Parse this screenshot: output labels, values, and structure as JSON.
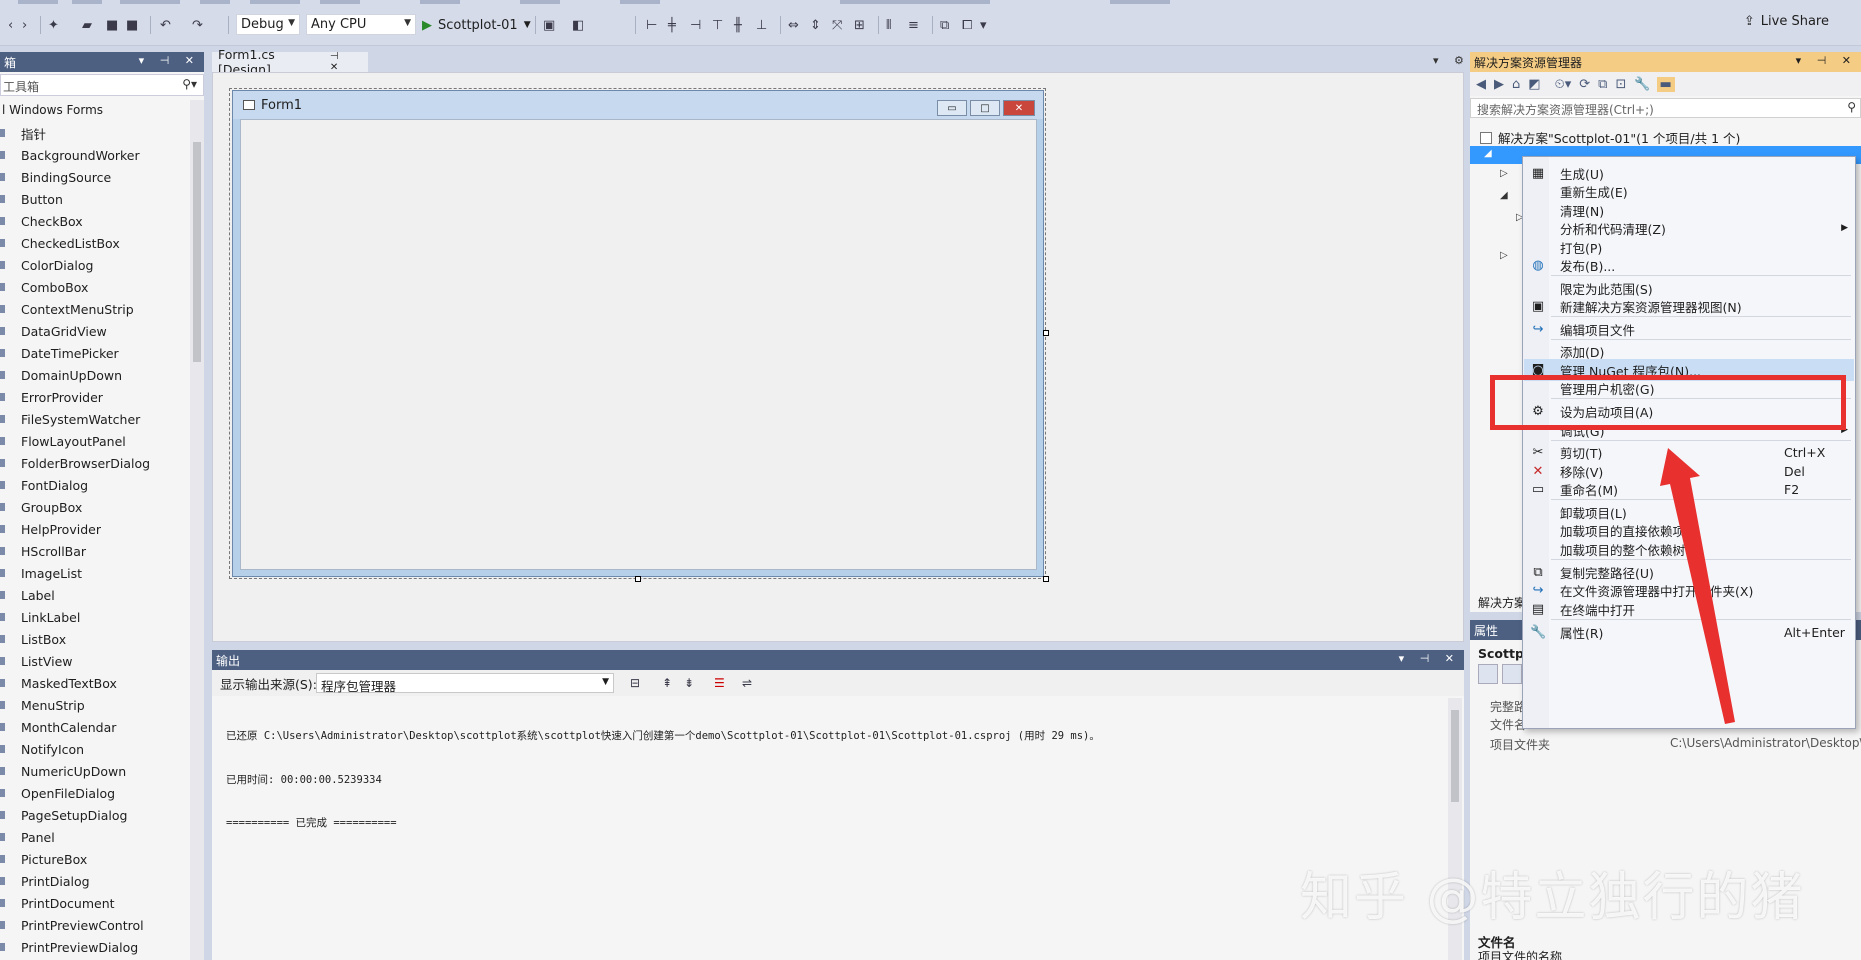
{
  "toolbar": {
    "config": "Debug",
    "platform": "Any CPU",
    "run_target": "Scottplot-01",
    "live_share": "Live Share"
  },
  "toolbox": {
    "title": "箱",
    "search_placeholder": "工具箱",
    "group": "l Windows Forms",
    "items": [
      "指针",
      "BackgroundWorker",
      "BindingSource",
      "Button",
      "CheckBox",
      "CheckedListBox",
      "ColorDialog",
      "ComboBox",
      "ContextMenuStrip",
      "DataGridView",
      "DateTimePicker",
      "DomainUpDown",
      "ErrorProvider",
      "FileSystemWatcher",
      "FlowLayoutPanel",
      "FolderBrowserDialog",
      "FontDialog",
      "GroupBox",
      "HelpProvider",
      "HScrollBar",
      "ImageList",
      "Label",
      "LinkLabel",
      "ListBox",
      "ListView",
      "MaskedTextBox",
      "MenuStrip",
      "MonthCalendar",
      "NotifyIcon",
      "NumericUpDown",
      "OpenFileDialog",
      "PageSetupDialog",
      "Panel",
      "PictureBox",
      "PrintDialog",
      "PrintDocument",
      "PrintPreviewControl",
      "PrintPreviewDialog"
    ]
  },
  "document": {
    "tab_label": "Form1.cs [Design]",
    "form_title": "Form1"
  },
  "output": {
    "title": "输出",
    "source_label": "显示输出来源(S):",
    "source_value": "程序包管理器",
    "lines": [
      "已还原 C:\\Users\\Administrator\\Desktop\\scottplot系统\\scottplot快速入门创建第一个demo\\Scottplot-01\\Scottplot-01\\Scottplot-01.csproj (用时 29 ms)。",
      "已用时间: 00:00:00.5239334",
      "========== 已完成 =========="
    ]
  },
  "solution": {
    "title": "解决方案资源管理器",
    "search_placeholder": "搜索解决方案资源管理器(Ctrl+;)",
    "root": "解决方案\"Scottplot-01\"(1 个项目/共 1 个)",
    "bottom_label": "解决方案"
  },
  "properties": {
    "title": "属性",
    "object": "Scottpl",
    "rows": [
      {
        "name": "完整路",
        "value": ""
      },
      {
        "name": "文件名",
        "value": ""
      },
      {
        "name": "项目文件夹",
        "value": "C:\\Users\\Administrator\\Desktop\\"
      }
    ],
    "desc_title": "文件名",
    "desc_text": "项目文件的名称"
  },
  "context_menu": {
    "items": [
      {
        "label": "生成(U)",
        "shortcut": "",
        "icon": "build-icon",
        "submenu": false
      },
      {
        "label": "重新生成(E)",
        "shortcut": "",
        "icon": "",
        "submenu": false
      },
      {
        "label": "清理(N)",
        "shortcut": "",
        "icon": "",
        "submenu": false
      },
      {
        "label": "分析和代码清理(Z)",
        "shortcut": "",
        "icon": "",
        "submenu": true
      },
      {
        "label": "打包(P)",
        "shortcut": "",
        "icon": "",
        "submenu": false
      },
      {
        "label": "发布(B)...",
        "shortcut": "",
        "icon": "globe-icon",
        "submenu": false
      },
      {
        "label": "限定为此范围(S)",
        "shortcut": "",
        "icon": "",
        "submenu": false
      },
      {
        "label": "新建解决方案资源管理器视图(N)",
        "shortcut": "",
        "icon": "new-view-icon",
        "submenu": false
      },
      {
        "label": "编辑项目文件",
        "shortcut": "",
        "icon": "edit-arrow-icon",
        "submenu": false
      },
      {
        "label": "添加(D)",
        "shortcut": "",
        "icon": "",
        "submenu": false
      },
      {
        "label": "管理 NuGet 程序包(N)...",
        "shortcut": "",
        "icon": "nuget-icon",
        "submenu": false
      },
      {
        "label": "管理用户机密(G)",
        "shortcut": "",
        "icon": "",
        "submenu": false
      },
      {
        "label": "设为启动项目(A)",
        "shortcut": "",
        "icon": "gear-icon",
        "submenu": false
      },
      {
        "label": "调试(G)",
        "shortcut": "",
        "icon": "",
        "submenu": true
      },
      {
        "label": "剪切(T)",
        "shortcut": "Ctrl+X",
        "icon": "scissors-icon",
        "submenu": false
      },
      {
        "label": "移除(V)",
        "shortcut": "Del",
        "icon": "remove-x-icon",
        "submenu": false
      },
      {
        "label": "重命名(M)",
        "shortcut": "F2",
        "icon": "rename-icon",
        "submenu": false
      },
      {
        "label": "卸载项目(L)",
        "shortcut": "",
        "icon": "",
        "submenu": false
      },
      {
        "label": "加载项目的直接依赖项",
        "shortcut": "",
        "icon": "",
        "submenu": false
      },
      {
        "label": "加载项目的整个依赖树",
        "shortcut": "",
        "icon": "",
        "submenu": false
      },
      {
        "label": "复制完整路径(U)",
        "shortcut": "",
        "icon": "copy-icon",
        "submenu": false
      },
      {
        "label": "在文件资源管理器中打开文件夹(X)",
        "shortcut": "",
        "icon": "open-folder-arrow-icon",
        "submenu": false
      },
      {
        "label": "在终端中打开",
        "shortcut": "",
        "icon": "terminal-icon",
        "submenu": false
      },
      {
        "label": "属性(R)",
        "shortcut": "Alt+Enter",
        "icon": "wrench-icon",
        "submenu": false
      }
    ]
  },
  "watermark": "知乎 @特立独行的猪",
  "colors": {
    "accent_tab": "#f5cc84",
    "panel_header": "#4d6082",
    "annotation_red": "#e8302f",
    "selection": "#3399ff"
  }
}
